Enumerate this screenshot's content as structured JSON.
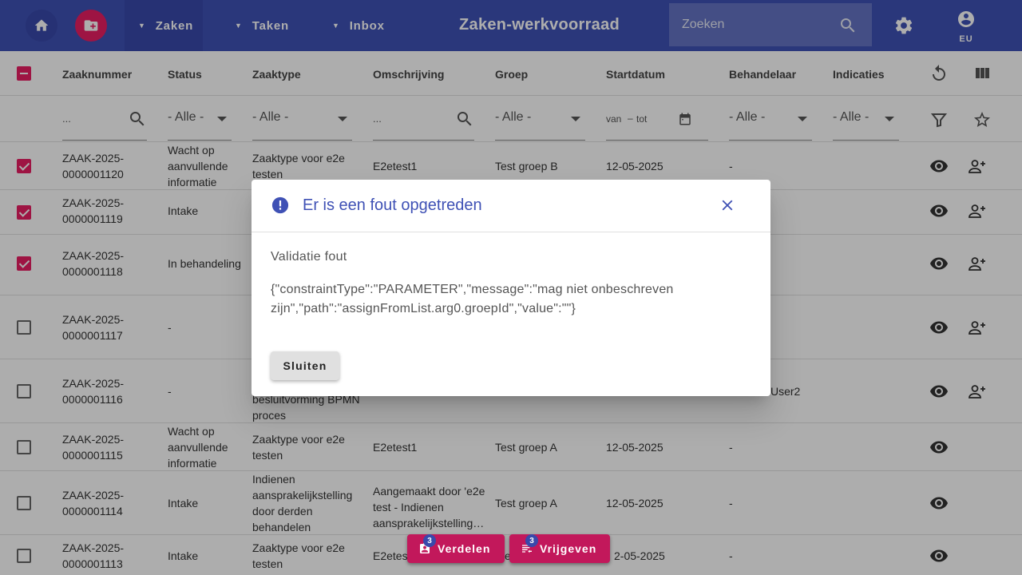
{
  "header": {
    "title": "Zaken-werkvoorraad",
    "nav": [
      {
        "label": "Zaken"
      },
      {
        "label": "Taken"
      },
      {
        "label": "Inbox"
      }
    ],
    "search_placeholder": "Zoeken",
    "account_label": "EU",
    "colors": {
      "bar": "#3f51b5",
      "accent": "#e91e63"
    }
  },
  "table": {
    "columns": [
      "Zaaknummer",
      "Status",
      "Zaaktype",
      "Omschrijving",
      "Groep",
      "Startdatum",
      "Behandelaar",
      "Indicaties"
    ],
    "filters": {
      "zaaknummer": "...",
      "status": "- Alle -",
      "zaaktype": "- Alle -",
      "omschrijving": "...",
      "groep": "- Alle -",
      "van": "van",
      "dash": "–",
      "tot": "tot",
      "behandelaar": "- Alle -",
      "indicaties": "- Alle -"
    },
    "rows": [
      {
        "nr": "ZAAK-2025-0000001120",
        "status": "Wacht op aanvullende informatie",
        "zaaktype": "Zaaktype voor e2e testen",
        "omschrijving": "E2etest1",
        "groep": "Test groep B",
        "startdatum": "12-05-2025",
        "behandelaar": "-",
        "checked": true
      },
      {
        "nr": "ZAAK-2025-0000001119",
        "status": "Intake",
        "zaaktype": "",
        "omschrijving": "",
        "groep": "",
        "startdatum": "",
        "behandelaar": "",
        "checked": true
      },
      {
        "nr": "ZAAK-2025-0000001118",
        "status": "In behandeling",
        "zaaktype": "",
        "omschrijving": "",
        "groep": "",
        "startdatum": "",
        "behandelaar": "",
        "checked": true
      },
      {
        "nr": "ZAAK-2025-0000001117",
        "status": "-",
        "zaaktype": "",
        "omschrijving": "",
        "groep": "",
        "startdatum": "",
        "behandelaar": "",
        "checked": false
      },
      {
        "nr": "ZAAK-2025-0000001116",
        "status": "-",
        "zaaktype": "besluitvorming BPMN proces",
        "omschrijving": "",
        "groep": "",
        "startdatum": "",
        "behandelaar": "User2",
        "checked": false
      },
      {
        "nr": "ZAAK-2025-0000001115",
        "status": "Wacht op aanvullende informatie",
        "zaaktype": "Zaaktype voor e2e testen",
        "omschrijving": "E2etest1",
        "groep": "Test groep A",
        "startdatum": "12-05-2025",
        "behandelaar": "-",
        "checked": false
      },
      {
        "nr": "ZAAK-2025-0000001114",
        "status": "Intake",
        "zaaktype": "Indienen aansprakelijkstelling door derden behandelen",
        "omschrijving": "Aangemaakt door 'e2e test - Indienen aansprakelijkstelling…",
        "groep": "Test groep A",
        "startdatum": "12-05-2025",
        "behandelaar": "-",
        "checked": false
      },
      {
        "nr": "ZAAK-2025-0000001113",
        "status": "Intake",
        "zaaktype": "Zaaktype voor e2e testen",
        "omschrijving": "E2etes",
        "groep": "es",
        "startdatum": "2-05-2025",
        "behandelaar": "-",
        "checked": false
      }
    ]
  },
  "actions": {
    "verdelen_label": "Verdelen",
    "verdelen_count": "3",
    "vrijgeven_label": "Vrijgeven",
    "vrijgeven_count": "3"
  },
  "dialog": {
    "title": "Er is een fout opgetreden",
    "subtitle": "Validatie fout",
    "message": "{\"constraintType\":\"PARAMETER\",\"message\":\"mag niet onbeschreven zijn\",\"path\":\"assignFromList.arg0.groepId\",\"value\":\"\"}",
    "button": "Sluiten"
  }
}
